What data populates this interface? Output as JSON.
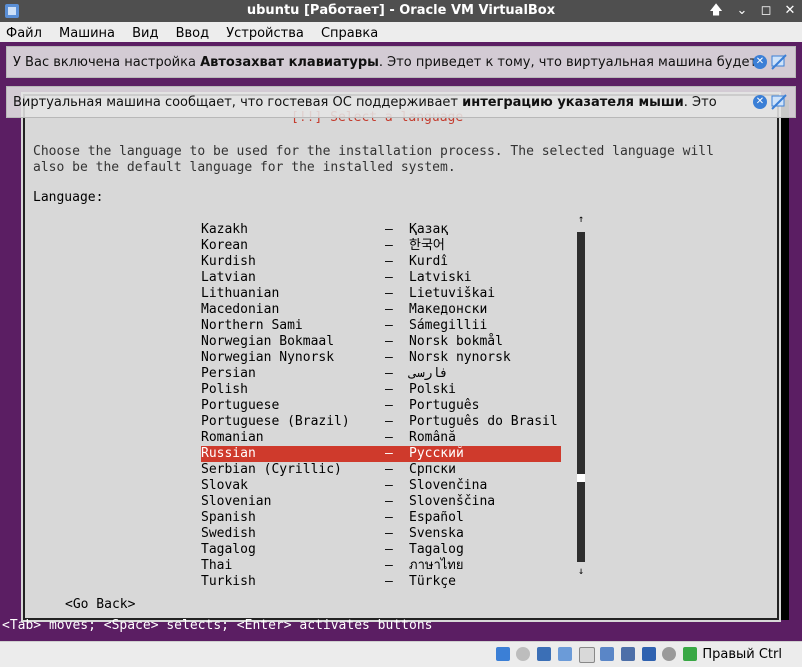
{
  "window": {
    "title": "ubuntu [Работает] - Oracle VM VirtualBox",
    "buttons": {
      "pin": "🡅",
      "minimize": "⌄",
      "maximize": "◻",
      "close": "✕"
    }
  },
  "menu": [
    "Файл",
    "Машина",
    "Вид",
    "Ввод",
    "Устройства",
    "Справка"
  ],
  "notifications": [
    {
      "prefix": "У Вас включена настройка ",
      "bold": "Автозахват клавиатуры",
      "suffix": ". Это приведет к тому, что виртуальная машина будет"
    },
    {
      "prefix": "Виртуальная машина сообщает, что гостевая ОС поддерживает ",
      "bold": "интеграцию указателя мыши",
      "suffix": ". Это"
    }
  ],
  "installer": {
    "title": "[!!] Select a language",
    "description_line1": "Choose the language to be used for the installation process. The selected language will",
    "description_line2": "also be the default language for the installed system.",
    "language_label": "Language:",
    "languages": [
      {
        "en": "Kazakh",
        "native": "Қазақ"
      },
      {
        "en": "Korean",
        "native": "한국어"
      },
      {
        "en": "Kurdish",
        "native": "Kurdî"
      },
      {
        "en": "Latvian",
        "native": "Latviski"
      },
      {
        "en": "Lithuanian",
        "native": "Lietuviškai"
      },
      {
        "en": "Macedonian",
        "native": "Македонски"
      },
      {
        "en": "Northern Sami",
        "native": "Sámegillii"
      },
      {
        "en": "Norwegian Bokmaal",
        "native": "Norsk bokmål"
      },
      {
        "en": "Norwegian Nynorsk",
        "native": "Norsk nynorsk"
      },
      {
        "en": "Persian",
        "native": "فارسی"
      },
      {
        "en": "Polish",
        "native": "Polski"
      },
      {
        "en": "Portuguese",
        "native": "Português"
      },
      {
        "en": "Portuguese (Brazil)",
        "native": "Português do Brasil"
      },
      {
        "en": "Romanian",
        "native": "Română"
      },
      {
        "en": "Russian",
        "native": "Русский"
      },
      {
        "en": "Serbian (Cyrillic)",
        "native": "Српски"
      },
      {
        "en": "Slovak",
        "native": "Slovenčina"
      },
      {
        "en": "Slovenian",
        "native": "Slovenščina"
      },
      {
        "en": "Spanish",
        "native": "Español"
      },
      {
        "en": "Swedish",
        "native": "Svenska"
      },
      {
        "en": "Tagalog",
        "native": "Tagalog"
      },
      {
        "en": "Thai",
        "native": "ภาษาไทย"
      },
      {
        "en": "Turkish",
        "native": "Türkçe"
      }
    ],
    "separator": "–",
    "selected": "Russian",
    "go_back": "<Go Back>",
    "scroll_up": "↑",
    "scroll_down": "↓",
    "hint": "<Tab> moves; <Space> selects; <Enter> activates buttons"
  },
  "statusbar": {
    "host_key": "Правый Ctrl",
    "icons": [
      "hard-disk-icon",
      "optical-drive-icon",
      "network-icon",
      "usb-icon",
      "shared-folders-icon",
      "display-icon",
      "video-capture-icon",
      "mouse-integration-icon",
      "keyboard-capture-icon"
    ]
  },
  "colors": {
    "vm_background": "#5b1e63",
    "dialog": "#d8d8d8",
    "selection": "#cf3a2c",
    "titlebar": "#4f4f4f"
  }
}
